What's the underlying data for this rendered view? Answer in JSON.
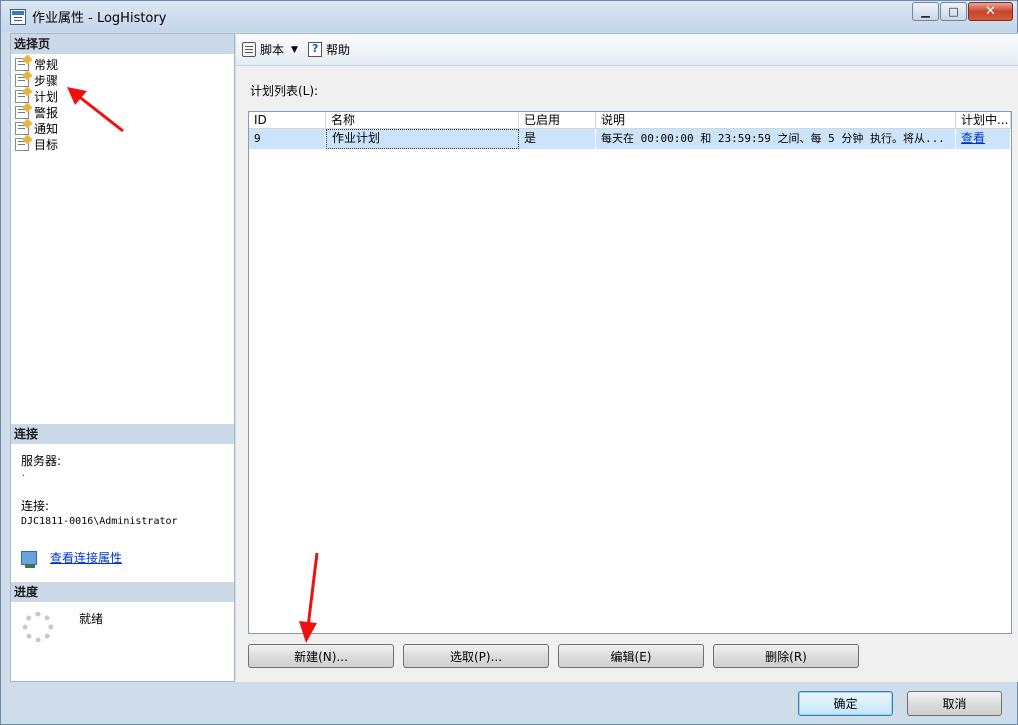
{
  "window": {
    "title": "作业属性 - LogHistory",
    "minimize": "0",
    "maximize": "□",
    "close": "✕"
  },
  "left_panel": {
    "select_page_header": "选择页",
    "pages": [
      {
        "label": "常规"
      },
      {
        "label": "步骤"
      },
      {
        "label": "计划"
      },
      {
        "label": "警报"
      },
      {
        "label": "通知"
      },
      {
        "label": "目标"
      }
    ],
    "connection": {
      "header": "连接",
      "server_label": "服务器:",
      "server_value": ".",
      "connection_label": "连接:",
      "connection_value": "DJC1811-0016\\Administrator",
      "view_properties_link": "查看连接属性"
    },
    "progress": {
      "header": "进度",
      "status": "就绪"
    }
  },
  "toolbar": {
    "script_label": "脚本",
    "help_label": "帮助"
  },
  "schedule_list": {
    "label": "计划列表(L):",
    "columns": [
      "ID",
      "名称",
      "已启用",
      "说明",
      "计划中..."
    ],
    "rows": [
      {
        "id": "9",
        "name": "作业计划",
        "enabled": "是",
        "description": "每天在 00:00:00 和 23:59:59 之间、每 5 分钟 执行。将从...",
        "schedule": "查看"
      }
    ]
  },
  "buttons": {
    "new": "新建(N)...",
    "pick": "选取(P)...",
    "edit": "编辑(E)",
    "delete": "删除(R)"
  },
  "footer": {
    "ok": "确定",
    "cancel": "取消"
  },
  "colors": {
    "accent_red": "#f01010",
    "selection_row": "#cce4fb",
    "link": "#0033cc"
  }
}
